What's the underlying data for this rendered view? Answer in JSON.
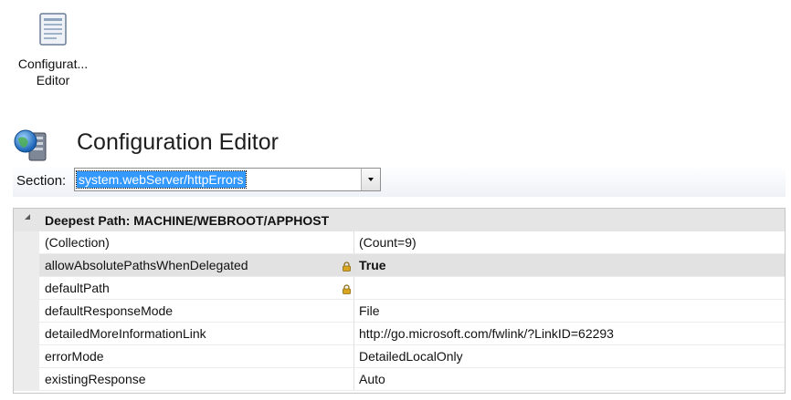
{
  "feature": {
    "icon": "config-editor-icon",
    "caption_line1": "Configurat...",
    "caption_line2": "Editor"
  },
  "page": {
    "title": "Configuration Editor",
    "title_icon": "globe-server-icon"
  },
  "section": {
    "label": "Section:",
    "value": "system.webServer/httpErrors"
  },
  "grid": {
    "header": "Deepest Path: MACHINE/WEBROOT/APPHOST",
    "rows": [
      {
        "name": "(Collection)",
        "value": "(Count=9)",
        "locked": false,
        "bold": false,
        "selected": false
      },
      {
        "name": "allowAbsolutePathsWhenDelegated",
        "value": "True",
        "locked": true,
        "bold": true,
        "selected": true
      },
      {
        "name": "defaultPath",
        "value": "",
        "locked": true,
        "bold": false,
        "selected": false
      },
      {
        "name": "defaultResponseMode",
        "value": "File",
        "locked": false,
        "bold": false,
        "selected": false
      },
      {
        "name": "detailedMoreInformationLink",
        "value": "http://go.microsoft.com/fwlink/?LinkID=62293",
        "locked": false,
        "bold": false,
        "selected": false
      },
      {
        "name": "errorMode",
        "value": "DetailedLocalOnly",
        "locked": false,
        "bold": false,
        "selected": false
      },
      {
        "name": "existingResponse",
        "value": "Auto",
        "locked": false,
        "bold": false,
        "selected": false
      }
    ]
  },
  "colors": {
    "selection_blue": "#3399ff",
    "lock_gold": "#c99a22"
  }
}
